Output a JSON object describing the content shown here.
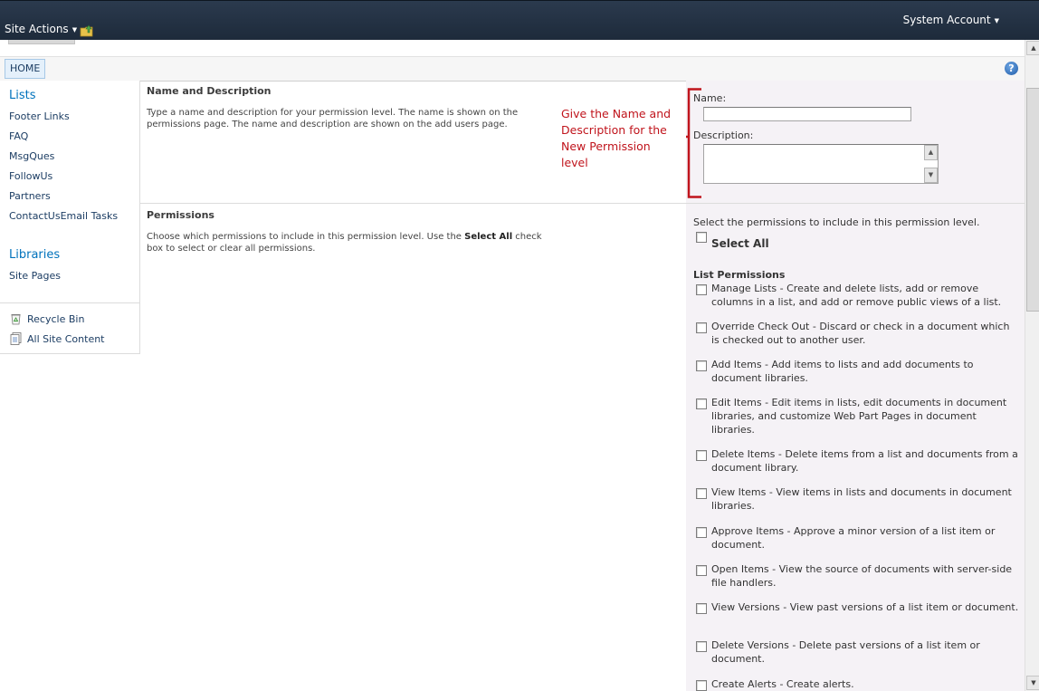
{
  "topbar": {
    "site_actions": "Site Actions",
    "navigate_up_icon": "folder-up-icon",
    "user": "System Account"
  },
  "ribbon": {
    "home_tab": "HOME",
    "help_icon": "help-icon",
    "help_glyph": "?"
  },
  "nav": {
    "lists_heading": "Lists",
    "list_links": [
      "Footer Links",
      "FAQ",
      "MsgQues",
      "FollowUs",
      "Partners",
      "ContactUsEmail Tasks"
    ],
    "libraries_heading": "Libraries",
    "library_links": [
      "Site Pages"
    ],
    "recycle_bin": "Recycle Bin",
    "all_site_content": "All Site Content"
  },
  "form": {
    "name_section": {
      "title": "Name and Description",
      "description": "Type a name and description for your permission level.  The name is shown on the permissions page.  The name and description are shown on the add users page.",
      "name_label": "Name:",
      "name_value": "",
      "description_label": "Description:",
      "description_value": ""
    },
    "annotation": "Give the Name and Description for the New Permission level",
    "permissions_section": {
      "title": "Permissions",
      "description_before": "Choose which permissions to include in this permission level.  Use the ",
      "description_bold": "Select All",
      "description_after": " check box to select or clear all permissions.",
      "intro": "Select the permissions to include in this permission level.",
      "select_all": "Select All",
      "list_permissions_heading": "List Permissions",
      "items": [
        "Manage Lists  -  Create and delete lists, add or remove columns in a list, and add or remove public views of a list.",
        "Override Check Out  -  Discard or check in a document which is checked out to another user.",
        "Add Items  -  Add items to lists and add documents to document libraries.",
        "Edit Items  -  Edit items in lists, edit documents in document libraries, and customize Web Part Pages in document libraries.",
        "Delete Items  -  Delete items from a list and documents from a document library.",
        "View Items  -  View items in lists and documents in document libraries.",
        "Approve Items  -  Approve a minor version of a list item or document.",
        "Open Items  -  View the source of documents with server-side file handlers.",
        "View Versions  -  View past versions of a list item or document.",
        "Delete Versions  -  Delete past versions of a list item or document.",
        "Create Alerts  -  Create alerts."
      ]
    }
  },
  "colors": {
    "topbar": "#1d2a3a",
    "link": "#0072bc",
    "annotation": "#c0141c",
    "form_panel": "#f5f2f6"
  }
}
